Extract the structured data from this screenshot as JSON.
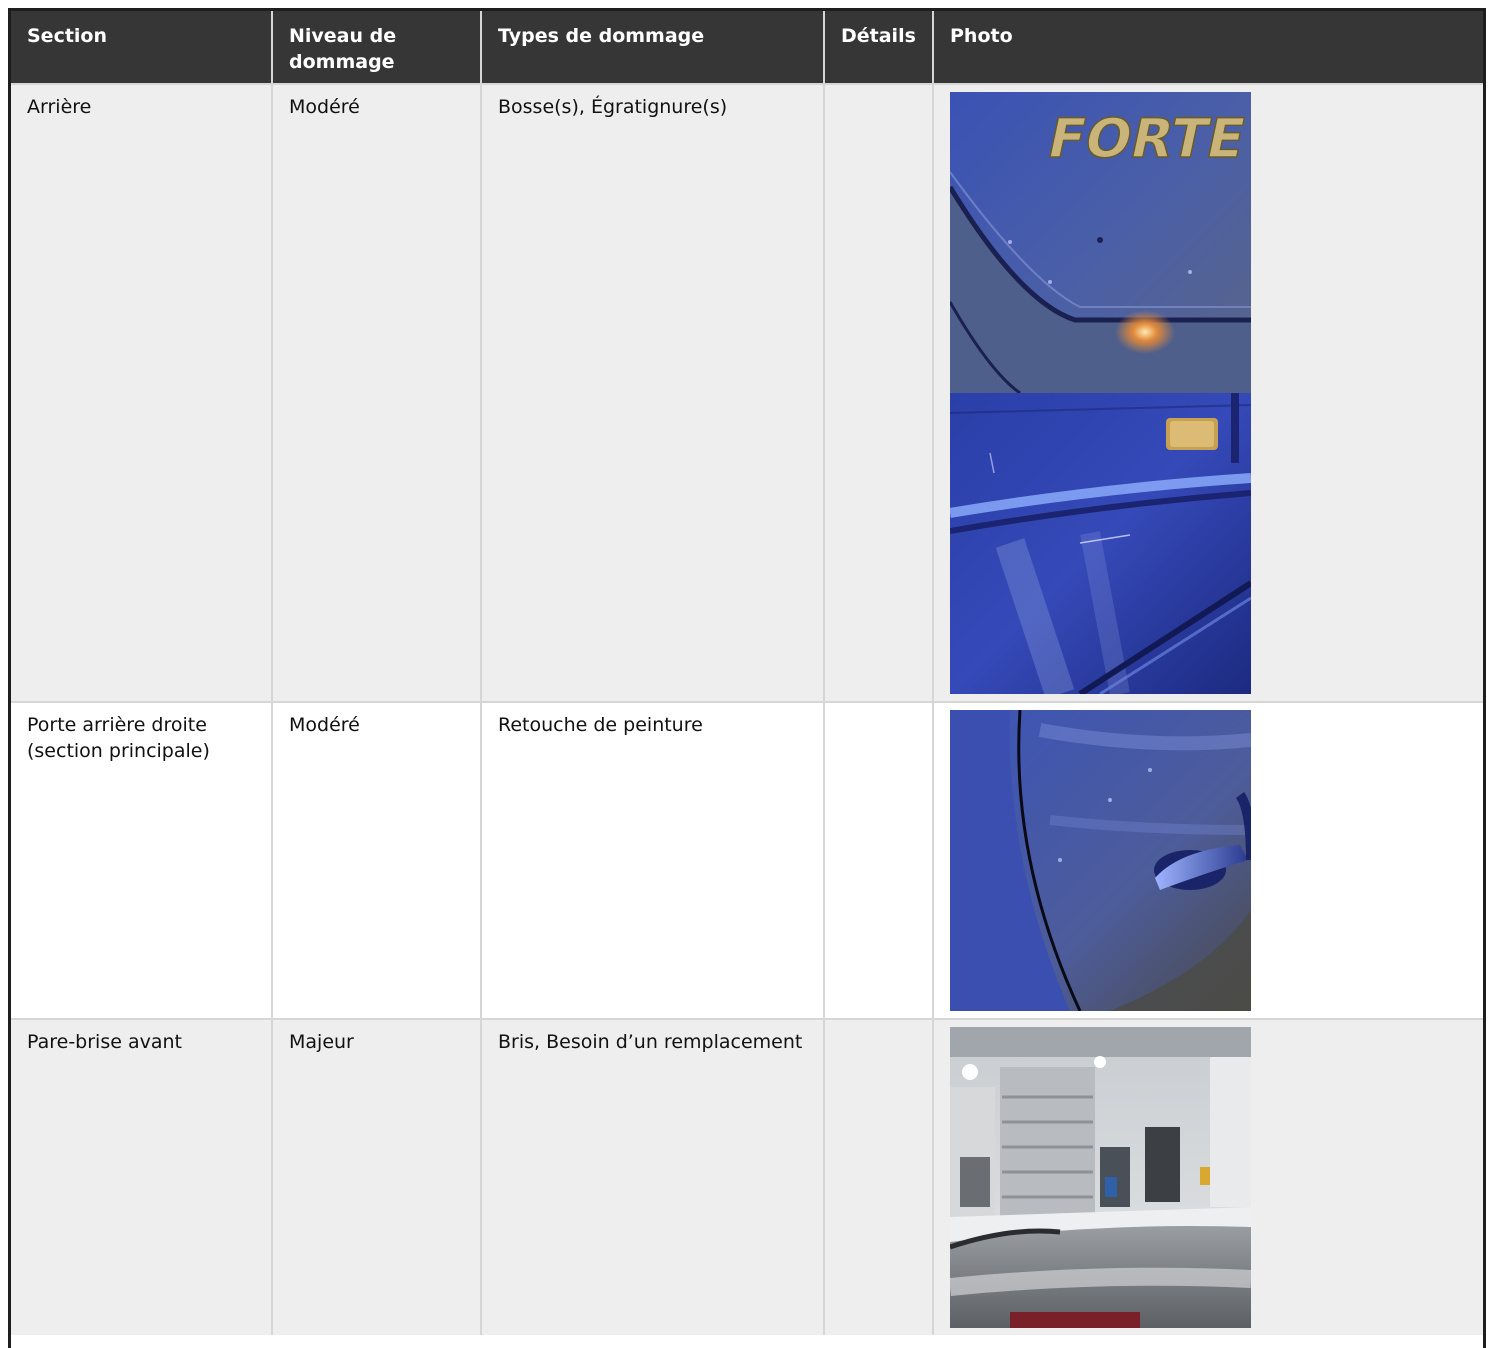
{
  "table": {
    "headers": {
      "section": "Section",
      "level": "Niveau de dommage",
      "types": "Types de dommage",
      "details": "Détails",
      "photo": "Photo"
    },
    "rows": [
      {
        "section": "Arrière",
        "level": "Modéré",
        "types": "Bosse(s), Égratignure(s)",
        "details": "",
        "photos": [
          "forte-trunk-badge-photo",
          "trunk-lid-scratch-photo"
        ]
      },
      {
        "section": "Porte arrière droite (section principale)",
        "level": "Modéré",
        "types": "Retouche de peinture",
        "details": "",
        "photos": [
          "rear-door-handle-photo"
        ]
      },
      {
        "section": "Pare-brise avant",
        "level": "Majeur",
        "types": "Bris, Besoin d’un remplacement",
        "details": "",
        "photos": [
          "garage-through-windshield-photo"
        ]
      }
    ]
  },
  "photo_label": {
    "forte_badge": "FORTE"
  },
  "colors": {
    "header_bg": "#363636",
    "row_alt_bg": "#eeeeee",
    "car_paint_blue": "#2f47a8"
  }
}
